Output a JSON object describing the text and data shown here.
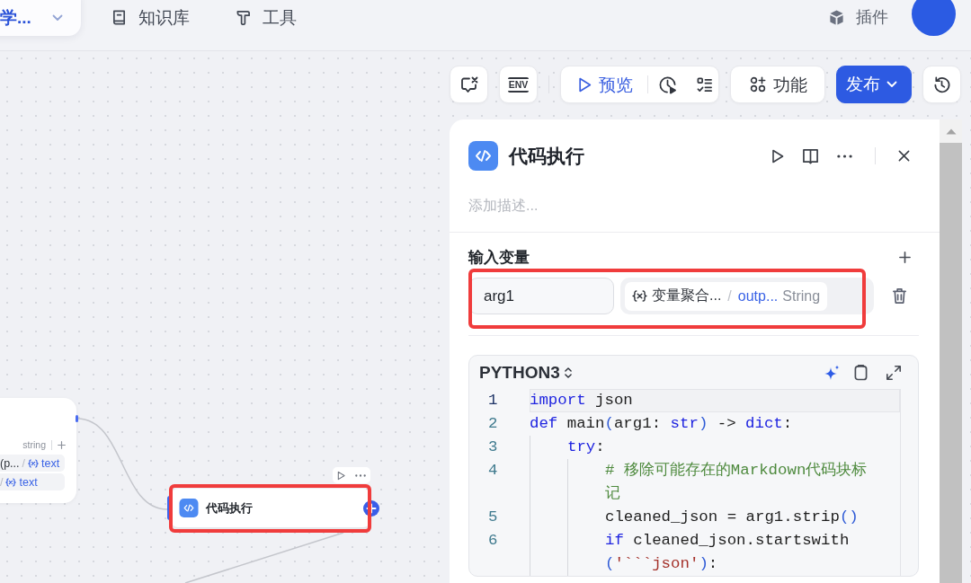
{
  "top_bar": {
    "workspace": {
      "name": "学..."
    },
    "nav": [
      {
        "label": "知识库",
        "kind": "knowledge"
      },
      {
        "label": "工具",
        "kind": "tools"
      }
    ],
    "plugins": {
      "label": "插件"
    }
  },
  "toolbar": {
    "env": {
      "label": "ENV"
    },
    "preview": {
      "label": "预览"
    },
    "features": {
      "label": "功能"
    },
    "publish": {
      "label": "发布"
    }
  },
  "canvas": {
    "upstream_node": {
      "type_label": "string",
      "rows": [
        {
          "value": "(p...",
          "separator": "/",
          "variable": "text"
        },
        {
          "separator": "/",
          "variable": "text"
        }
      ]
    },
    "code_node": {
      "title": "代码执行"
    }
  },
  "panel": {
    "title": "代码执行",
    "description": {
      "placeholder": "添加描述..."
    },
    "inputs_title": "输入变量",
    "inputs": [
      {
        "name": "arg1",
        "source_node": "变量聚合...",
        "separator": "/",
        "source_field": "outp...",
        "type": "String"
      }
    ],
    "code": {
      "language": "PYTHON3",
      "lines": [
        {
          "number": "1",
          "current": true,
          "tokens": [
            {
              "kind": "keyword",
              "text": "import"
            },
            {
              "kind": "plain",
              "text": " json"
            }
          ]
        },
        {
          "number": "2",
          "current": false,
          "tokens": [
            {
              "kind": "keyword",
              "text": "def"
            },
            {
              "kind": "plain",
              "text": " main"
            },
            {
              "kind": "bracket",
              "text": "("
            },
            {
              "kind": "plain",
              "text": "arg1: "
            },
            {
              "kind": "keyword",
              "text": "str"
            },
            {
              "kind": "bracket",
              "text": ")"
            },
            {
              "kind": "plain",
              "text": " -> "
            },
            {
              "kind": "keyword",
              "text": "dict"
            },
            {
              "kind": "plain",
              "text": ":"
            }
          ],
          "children": [
            {
              "number": "3",
              "current": false,
              "tokens": [
                {
                  "kind": "keyword",
                  "text": "try"
                },
                {
                  "kind": "plain",
                  "text": ":"
                }
              ],
              "children": [
                {
                  "number": "4",
                  "current": false,
                  "tokens": [
                    {
                      "kind": "comment",
                      "text": "# 移除可能存在的Markdown代码块标记"
                    }
                  ]
                },
                {
                  "number": "5",
                  "current": false,
                  "tokens": [
                    {
                      "kind": "plain",
                      "text": "cleaned_json = arg1.strip"
                    },
                    {
                      "kind": "bracket",
                      "text": "()"
                    }
                  ]
                },
                {
                  "number": "6",
                  "current": false,
                  "tokens": [
                    {
                      "kind": "keyword",
                      "text": "if"
                    },
                    {
                      "kind": "plain",
                      "text": " cleaned_json.startswith"
                    },
                    {
                      "kind": "bracket",
                      "text": "("
                    },
                    {
                      "kind": "string",
                      "text": "'```json'"
                    },
                    {
                      "kind": "bracket",
                      "text": ")"
                    },
                    {
                      "kind": "plain",
                      "text": ":"
                    }
                  ]
                }
              ]
            }
          ]
        }
      ]
    }
  }
}
